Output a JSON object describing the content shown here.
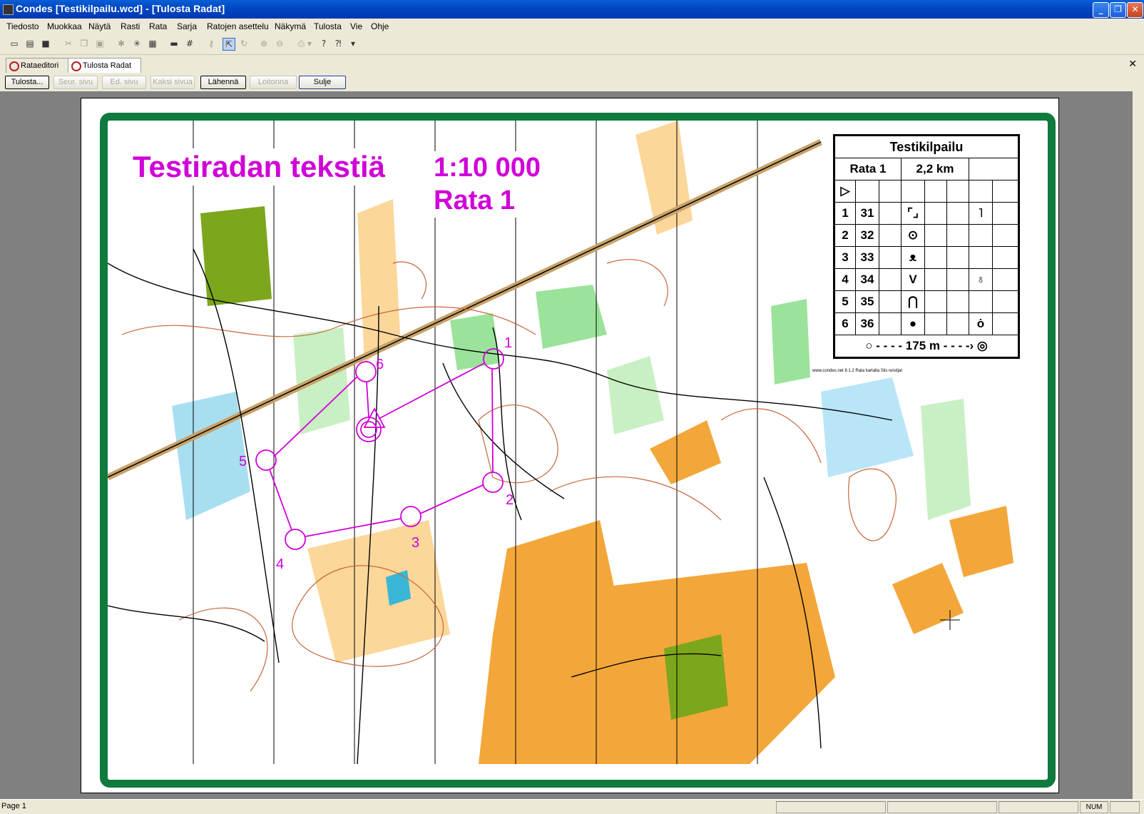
{
  "window": {
    "title": "Condes [Testikilpailu.wcd] - [Tulosta Radat]"
  },
  "menu": [
    "Tiedosto",
    "Muokkaa",
    "Näytä",
    "Rasti",
    "Rata",
    "Sarja",
    "Ratojen asettelu",
    "Näkymä",
    "Tulosta",
    "Vie",
    "Ohje"
  ],
  "tabs": [
    "Rataeditori",
    "Tulosta Radat"
  ],
  "print_buttons": {
    "print": "Tulosta...",
    "next": "Seur. sivu",
    "prev": "Ed. sivu",
    "two": "Kaksi sivua",
    "zoom_in": "Lähennä",
    "zoom_out": "Loitonna",
    "close": "Sulje"
  },
  "map": {
    "title_text": "Testiradan tekstiä",
    "scale": "1:10 000",
    "course": "Rata 1",
    "controls": [
      "1",
      "2",
      "3",
      "4",
      "5",
      "6"
    ],
    "credit": "www.condes.net 8.1.2 Rata kartalla Siis reistijat"
  },
  "description": {
    "event": "Testikilpailu",
    "course": "Rata 1",
    "length": "2,2 km",
    "rows": [
      {
        "n": "1",
        "code": "31"
      },
      {
        "n": "2",
        "code": "32"
      },
      {
        "n": "3",
        "code": "33"
      },
      {
        "n": "4",
        "code": "34"
      },
      {
        "n": "5",
        "code": "35"
      },
      {
        "n": "6",
        "code": "36"
      }
    ],
    "finish": "175 m"
  },
  "status": {
    "page": "Page 1",
    "num": "NUM"
  },
  "colors": {
    "accent": "#0e7a3e",
    "course": "#d000d8",
    "orange": "#f3a73a",
    "green": "#9be39a",
    "olive": "#7ca61c"
  }
}
